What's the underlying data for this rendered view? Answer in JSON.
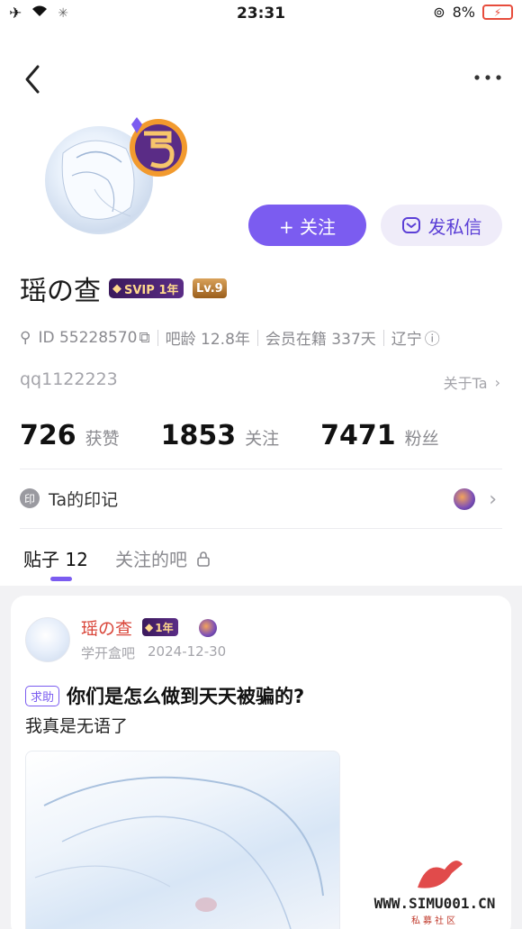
{
  "status_bar": {
    "time": "23:31",
    "battery": "8%"
  },
  "header": {
    "more_label": "•••"
  },
  "profile": {
    "name": "瑶の查",
    "svip_label": "SVIP 1年",
    "level_label": "Lv.9",
    "id_label": "ID 55228570",
    "bar_age": "吧龄 12.8年",
    "member_days": "会员在籍 337天",
    "location": "辽宁",
    "nickname": "qq1122223",
    "about_label": "关于Ta"
  },
  "actions": {
    "follow_label": "+ 关注",
    "message_label": "发私信"
  },
  "stats": [
    {
      "value": "726",
      "label": "获赞"
    },
    {
      "value": "1853",
      "label": "关注"
    },
    {
      "value": "7471",
      "label": "粉丝"
    }
  ],
  "marks": {
    "icon_char": "印",
    "label": "Ta的印记"
  },
  "tabs": {
    "posts": "贴子 12",
    "followed_bars": "关注的吧"
  },
  "post": {
    "author": "瑶の查",
    "vip_label": "1年",
    "forum": "学开盒吧",
    "date": "2024-12-30",
    "tag": "求助",
    "title": "你们是怎么做到天天被骗的?",
    "body": "我真是无语了"
  },
  "watermark": {
    "url": "WWW.SIMU001.CN",
    "sub": "私募社区"
  },
  "colors": {
    "accent": "#7b5cf0",
    "author_red": "#d9463a"
  }
}
